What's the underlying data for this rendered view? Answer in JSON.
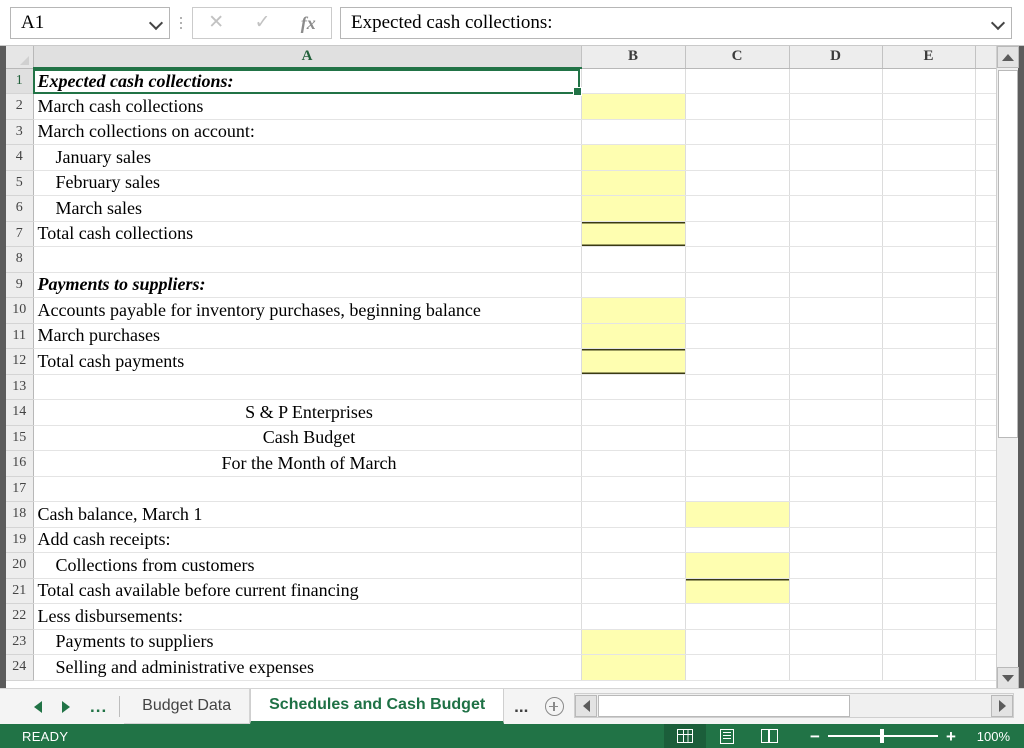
{
  "formula_bar": {
    "name_box_value": "A1",
    "formula_value": "Expected cash collections:",
    "cancel_icon": "close-icon",
    "confirm_icon": "check-icon",
    "function_icon": "fx-icon"
  },
  "grid": {
    "columns": [
      "A",
      "B",
      "C",
      "D",
      "E"
    ],
    "selected_column": "A",
    "selected_row": 1,
    "rows": [
      {
        "n": 1,
        "a": "Expected cash collections:",
        "style": "bold-italic"
      },
      {
        "n": 2,
        "a": "March cash collections",
        "style": "normal"
      },
      {
        "n": 3,
        "a": "March collections on account:",
        "style": "normal"
      },
      {
        "n": 4,
        "a": "January sales",
        "style": "indent"
      },
      {
        "n": 5,
        "a": "February sales",
        "style": "indent"
      },
      {
        "n": 6,
        "a": "March sales",
        "style": "indent"
      },
      {
        "n": 7,
        "a": "Total cash collections",
        "style": "normal"
      },
      {
        "n": 8,
        "a": "",
        "style": "normal"
      },
      {
        "n": 9,
        "a": "Payments to suppliers:",
        "style": "bold-italic"
      },
      {
        "n": 10,
        "a": "Accounts payable for inventory purchases, beginning balance",
        "style": "normal"
      },
      {
        "n": 11,
        "a": "March purchases",
        "style": "normal"
      },
      {
        "n": 12,
        "a": "Total cash payments",
        "style": "normal"
      },
      {
        "n": 13,
        "a": "",
        "style": "normal"
      },
      {
        "n": 14,
        "a": "S & P Enterprises",
        "style": "center"
      },
      {
        "n": 15,
        "a": "Cash Budget",
        "style": "center"
      },
      {
        "n": 16,
        "a": "For the Month of March",
        "style": "center"
      },
      {
        "n": 17,
        "a": "",
        "style": "normal"
      },
      {
        "n": 18,
        "a": "Cash balance, March 1",
        "style": "normal"
      },
      {
        "n": 19,
        "a": "Add cash receipts:",
        "style": "normal"
      },
      {
        "n": 20,
        "a": "Collections from customers",
        "style": "indent"
      },
      {
        "n": 21,
        "a": "Total cash available before current financing",
        "style": "normal"
      },
      {
        "n": 22,
        "a": "Less disbursements:",
        "style": "normal"
      },
      {
        "n": 23,
        "a": "Payments to suppliers",
        "style": "indent"
      },
      {
        "n": 24,
        "a": "Selling and administrative expenses",
        "style": "indent"
      }
    ],
    "highlight_color": "#FEFEB0",
    "highlighted_cells": [
      "B2",
      "B4",
      "B5",
      "B6",
      "B7",
      "B10",
      "B11",
      "B12",
      "C18",
      "C20",
      "C21",
      "B23",
      "B24"
    ],
    "top_border_cells": [
      "B7",
      "B12",
      "C21"
    ],
    "double_bottom_border_cells": [
      "B7",
      "B12"
    ]
  },
  "tabbar": {
    "nav_first": "first-sheet",
    "nav_prev": "previous-sheet",
    "nav_more_left": "...",
    "tabs": [
      {
        "label": "Budget Data",
        "active": false
      },
      {
        "label": "Schedules and Cash Budget",
        "active": true
      }
    ],
    "more_label": "...",
    "add_sheet_icon": "plus-circle-icon"
  },
  "statusbar": {
    "status": "READY",
    "views": [
      {
        "name": "normal-view",
        "active": true
      },
      {
        "name": "page-layout-view",
        "active": false
      },
      {
        "name": "page-break-view",
        "active": false
      }
    ],
    "zoom_out": "−",
    "zoom_in": "+",
    "zoom_level": "100%",
    "accent_color": "#217346"
  }
}
